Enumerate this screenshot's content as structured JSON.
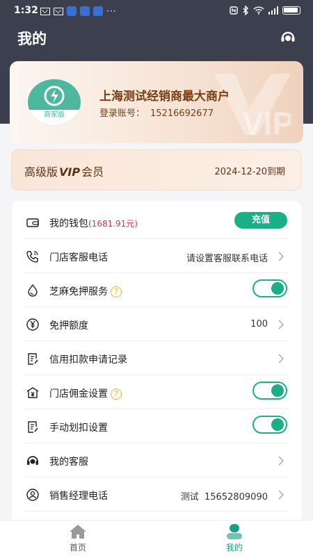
{
  "status_bar": {
    "time": "1:32",
    "more": "···"
  },
  "page": {
    "title": "我的"
  },
  "merchant": {
    "logo_text": "商家版",
    "name": "上海测试经销商最大商户",
    "account_label": "登录账号：",
    "account": "15216692677",
    "watermark": "VIP"
  },
  "vip": {
    "level_prefix": "高级版",
    "level_vip": "VIP",
    "level_suffix": "会员",
    "expire": "2024-12-20到期"
  },
  "menu": {
    "wallet": {
      "label": "我的钱包",
      "amount": "(1681.91元)",
      "action": "充值"
    },
    "store_phone": {
      "label": "门店客服电话",
      "value": "请设置客服联系电话"
    },
    "sesame": {
      "label": "芝麻免押服务",
      "help": "?",
      "enabled": true
    },
    "deposit_quota": {
      "label": "免押额度",
      "value": "100"
    },
    "credit_records": {
      "label": "信用扣款申请记录"
    },
    "commission": {
      "label": "门店佣金设置",
      "help": "?",
      "enabled": true
    },
    "manual_deduct": {
      "label": "手动划扣设置",
      "enabled": true
    },
    "my_service": {
      "label": "我的客服"
    },
    "sales_manager": {
      "label": "销售经理电话",
      "value": "测试  15652809090"
    }
  },
  "tabs": {
    "home": "首页",
    "mine": "我的"
  },
  "colors": {
    "accent": "#1aaf86",
    "header": "#3c3f4e",
    "warning": "#f2b320",
    "price": "#d9363e"
  }
}
